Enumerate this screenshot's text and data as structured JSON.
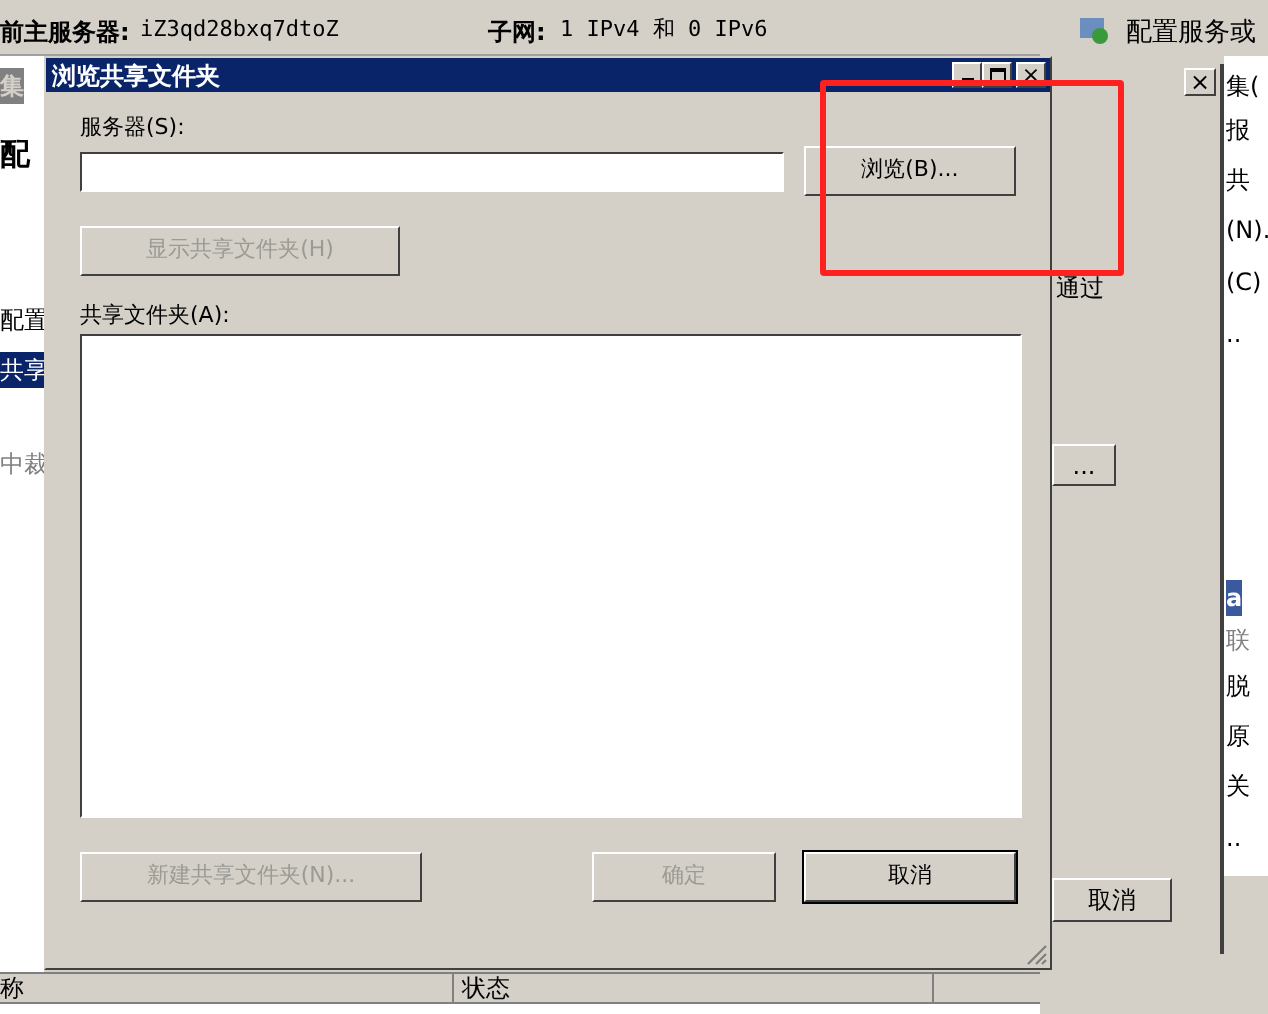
{
  "background": {
    "server_label": "前主服务器:",
    "server_value": "iZ3qd28bxq7dtoZ",
    "subnet_label": "子网:",
    "subnet_value": "1 IPv4 和 0 IPv6",
    "left_texts": [
      {
        "text": "集",
        "kind": "header"
      },
      {
        "text": "配",
        "kind": "bold"
      },
      {
        "text": "配置",
        "kind": "plain"
      },
      {
        "text": "共享",
        "kind": "selected"
      },
      {
        "text": "中裁",
        "kind": "grey"
      }
    ],
    "right_action": "配置服务或",
    "right_items": [
      {
        "text": "集(",
        "kind": "plain"
      },
      {
        "text": "报",
        "kind": "plain"
      },
      {
        "text": "共",
        "kind": "plain"
      },
      {
        "text": "(N).",
        "kind": "plain"
      },
      {
        "text": "(C)",
        "kind": "plain"
      },
      {
        "text": "..",
        "kind": "plain"
      },
      {
        "text": "a",
        "kind": "header"
      },
      {
        "text": "联",
        "kind": "grey"
      },
      {
        "text": "脱",
        "kind": "plain"
      },
      {
        "text": "原",
        "kind": "plain"
      },
      {
        "text": "关",
        "kind": "plain"
      },
      {
        "text": "..",
        "kind": "plain"
      }
    ],
    "middle_text": "通过",
    "middle_button": "...",
    "middle_cancel": "取消",
    "close_glyph": "×",
    "columns": [
      "称",
      "状态"
    ]
  },
  "dialog": {
    "title": "浏览共享文件夹",
    "server_label": "服务器(S):",
    "browse_button": "浏览(B)...",
    "show_button": {
      "label": "显示共享文件夹(H)",
      "disabled": true
    },
    "folders_label": "共享文件夹(A):",
    "buttons": [
      {
        "label": "新建共享文件夹(N)...",
        "disabled": true,
        "default": false
      },
      {
        "label": "确定",
        "disabled": true,
        "default": false
      },
      {
        "label": "取消",
        "disabled": false,
        "default": true
      }
    ]
  }
}
